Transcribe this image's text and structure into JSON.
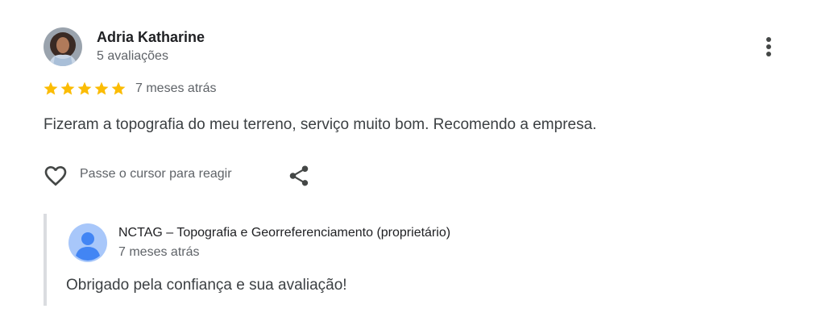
{
  "review": {
    "author_name": "Adria Katharine",
    "author_meta": "5 avaliações",
    "rating": 5,
    "rating_max": 5,
    "star_color": "#fbbc04",
    "time": "7 meses atrás",
    "text": "Fizeram a topografia do meu terreno, serviço muito bom. Recomendo a empresa.",
    "react_hint": "Passe o cursor para reagir"
  },
  "reply": {
    "owner": "NCTAG – Topografia e Georreferenciamento (proprietário)",
    "time": "7 meses atrás",
    "text": "Obrigado pela confiança e sua avaliação!",
    "avatar_color": "#a8c7fa",
    "avatar_figure_color": "#4285f4"
  },
  "icons": {
    "menu": "more-vertical-icon",
    "like": "heart-outline-icon",
    "share": "share-icon",
    "star": "star-icon"
  }
}
